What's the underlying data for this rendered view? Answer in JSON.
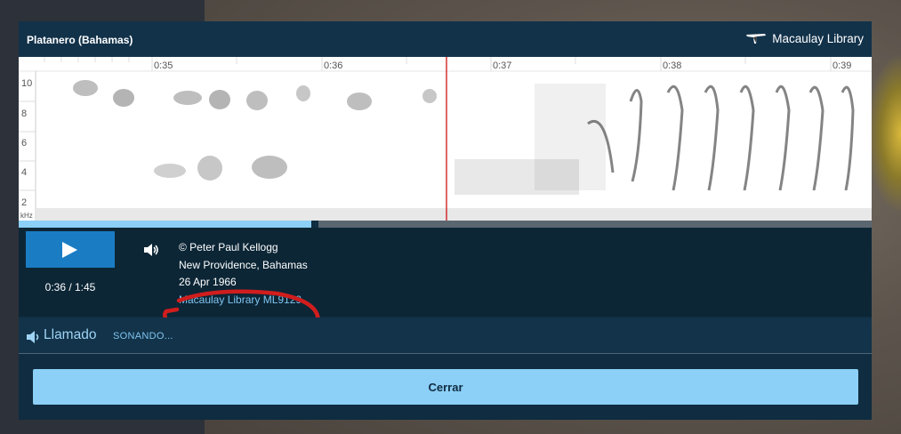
{
  "modal": {
    "title": "Platanero (Bahamas)",
    "brand": "Macaulay Library"
  },
  "spectrogram": {
    "time_ticks": [
      "0:35",
      "0:36",
      "0:37",
      "0:38",
      "0:39"
    ],
    "freq_ticks": [
      "10",
      "8",
      "6",
      "4",
      "2"
    ],
    "freq_unit": "kHz"
  },
  "player": {
    "time": "0:36 / 1:45",
    "progress_fraction": 0.343,
    "credit": "© Peter Paul Kellogg",
    "location": "New Providence, Bahamas",
    "date": "26 Apr 1966",
    "catalog_link": "Macaulay Library ML9129"
  },
  "call": {
    "label": "Llamado",
    "status": "SONANDO..."
  },
  "close_label": "Cerrar",
  "colors": {
    "modal_bg": "#0f2c40",
    "play_button": "#1a7dc4",
    "accent_light": "#8ccff7",
    "link": "#7fc4ef",
    "annotation_circle": "#d11d1d",
    "playhead": "#cc0000"
  }
}
